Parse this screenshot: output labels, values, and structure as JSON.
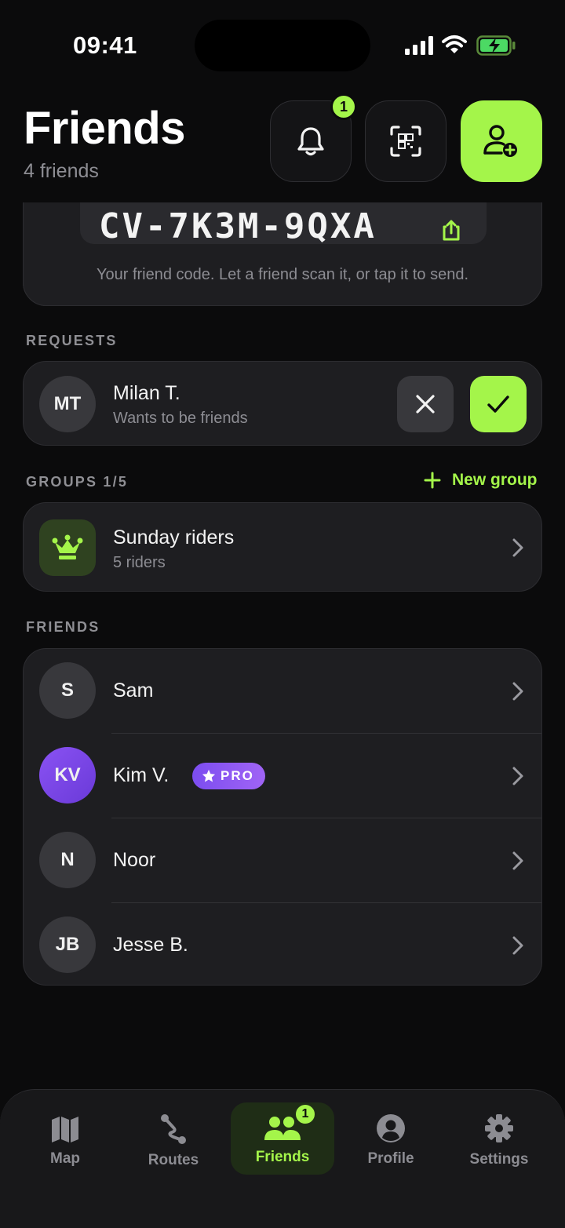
{
  "status_bar": {
    "time": "09:41"
  },
  "header": {
    "title": "Friends",
    "subtitle": "4 friends",
    "notifications_count": "1"
  },
  "friend_code": {
    "code": "CV-7K3M-9QXA",
    "note": "Your friend code. Let a friend scan it, or tap it to send."
  },
  "requests": {
    "label": "REQUESTS",
    "items": [
      {
        "initials": "MT",
        "name": "Milan T.",
        "subtitle": "Wants to be friends"
      }
    ]
  },
  "groups": {
    "label": "GROUPS 1/5",
    "new_group_label": "New group",
    "items": [
      {
        "name": "Sunday riders",
        "subtitle": "5 riders",
        "icon": "crown-icon"
      }
    ]
  },
  "friends": {
    "label": "FRIENDS",
    "items": [
      {
        "initials": "S",
        "name": "Sam"
      },
      {
        "initials": "KV",
        "name": "Kim V.",
        "badge": "PRO"
      },
      {
        "initials": "N",
        "name": "Noor"
      },
      {
        "initials": "JB",
        "name": "Jesse B."
      }
    ]
  },
  "tabbar": {
    "tabs": [
      {
        "label": "Map",
        "icon": "map-icon"
      },
      {
        "label": "Routes",
        "icon": "route-icon"
      },
      {
        "label": "Friends",
        "icon": "friends-icon",
        "active": true,
        "badge": "1"
      },
      {
        "label": "Profile",
        "icon": "profile-icon"
      },
      {
        "label": "Settings",
        "icon": "gear-icon"
      }
    ]
  },
  "colors": {
    "accent": "#a4f54a",
    "background": "#0b0b0c",
    "card": "#1e1e21",
    "pro_badge": "#8a52f3"
  }
}
